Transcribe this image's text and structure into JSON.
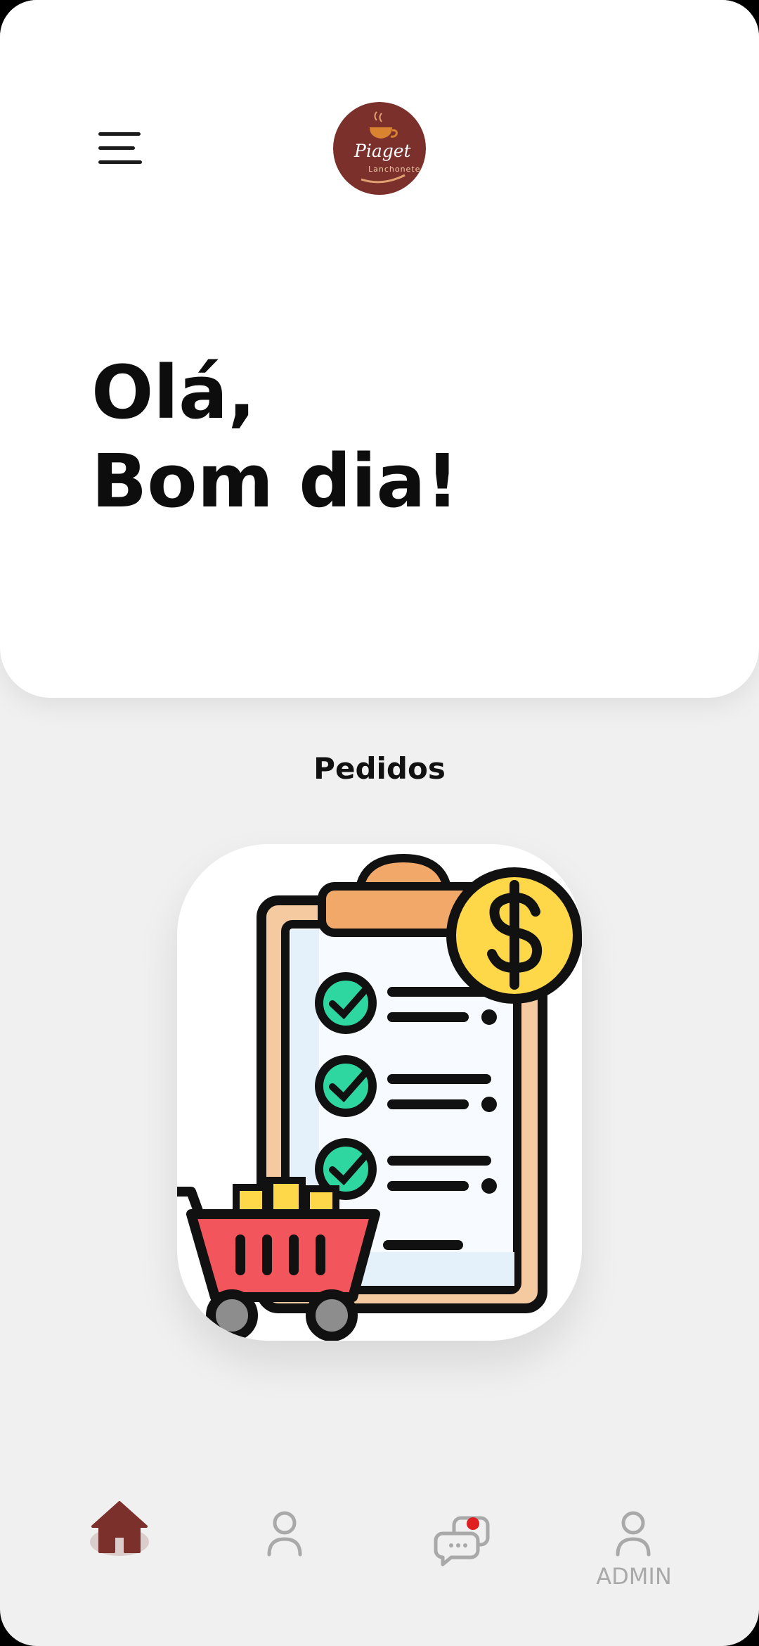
{
  "header": {
    "logo": {
      "wordmark": "Piaget",
      "tagline": "Lanchonete",
      "color": "#7c302b"
    }
  },
  "greeting": {
    "line1": "Olá,",
    "line2": "Bom dia!"
  },
  "section": {
    "title": "Pedidos"
  },
  "card": {
    "icon": "orders-clipboard-cart-icon"
  },
  "bottom_nav": {
    "items": [
      {
        "icon": "home-icon",
        "active": true
      },
      {
        "icon": "user-icon",
        "active": false
      },
      {
        "icon": "chat-icon",
        "active": false,
        "has_notification": true
      },
      {
        "icon": "user-icon",
        "label": "ADMIN",
        "active": false
      }
    ],
    "active_color": "#7c302b",
    "inactive_color": "#a9a9a9",
    "notification_color": "#e02020"
  }
}
